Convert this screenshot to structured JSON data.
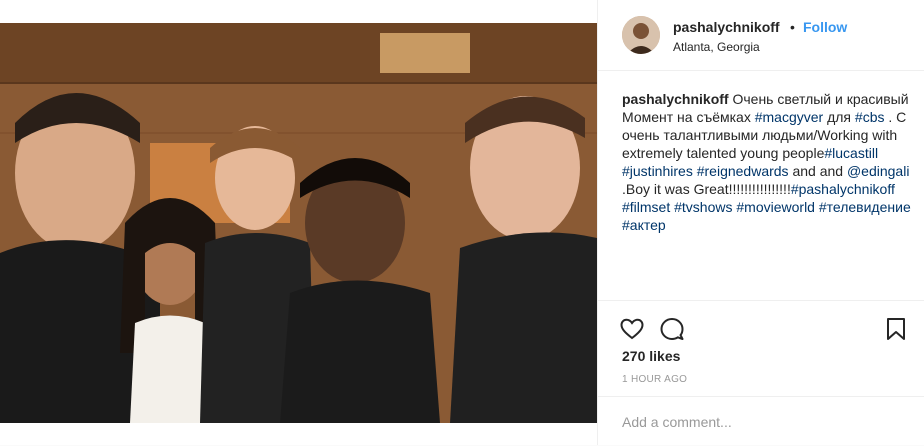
{
  "post": {
    "photo_alt_icon": "group-photo",
    "author": {
      "username": "pashalychnikoff",
      "location": "Atlanta, Georgia",
      "follow_label": "Follow",
      "separator": "•"
    },
    "caption": {
      "username": "pashalychnikoff",
      "segments": [
        {
          "text": " Очень светлый и красивый Момент на съёмках ",
          "tag": false
        },
        {
          "text": "#macgyver",
          "tag": true
        },
        {
          "text": " для ",
          "tag": false
        },
        {
          "text": "#cbs",
          "tag": true
        },
        {
          "text": " . С очень талантливыми людьми/Working with extremely talented young people",
          "tag": false
        },
        {
          "text": "#lucastill",
          "tag": true
        },
        {
          "text": " ",
          "tag": false
        },
        {
          "text": "#justinhires",
          "tag": true
        },
        {
          "text": " ",
          "tag": false
        },
        {
          "text": "#reignedwards",
          "tag": true
        },
        {
          "text": " and and ",
          "tag": false
        },
        {
          "text": "@edingali",
          "tag": true
        },
        {
          "text": " .Boy it was Great!!!!!!!!!!!!!!!!",
          "tag": false
        },
        {
          "text": "#pashalychnikoff",
          "tag": true
        },
        {
          "text": " ",
          "tag": false
        },
        {
          "text": "#filmset",
          "tag": true
        },
        {
          "text": " ",
          "tag": false
        },
        {
          "text": "#tvshows",
          "tag": true
        },
        {
          "text": " ",
          "tag": false
        },
        {
          "text": "#movieworld",
          "tag": true
        },
        {
          "text": " ",
          "tag": false
        },
        {
          "text": "#телевидение",
          "tag": true
        },
        {
          "text": " ",
          "tag": false
        },
        {
          "text": "#актер",
          "tag": true
        }
      ]
    },
    "actions": {
      "like_icon": "heart-icon",
      "comment_icon": "comment-bubble-icon",
      "save_icon": "bookmark-icon"
    },
    "likes_text": "270 likes",
    "timestamp": "1 HOUR AGO",
    "comment_placeholder": "Add a comment..."
  },
  "colors": {
    "link": "#003569",
    "follow": "#3897f0",
    "muted": "#999999",
    "text": "#262626"
  }
}
